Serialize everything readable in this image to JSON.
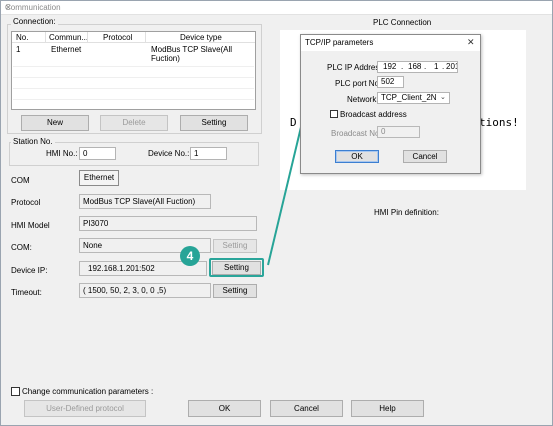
{
  "window": {
    "title": "Communication",
    "close_symbol": "✕"
  },
  "connection": {
    "group_label": "Connection:",
    "columns": [
      "No.",
      "Commun...",
      "Protocol",
      "Device type"
    ],
    "rows": [
      {
        "no": "1",
        "comm": "Ethernet",
        "protocol": "",
        "device_type": "ModBus TCP Slave(All Fuction)"
      }
    ],
    "buttons": {
      "new": "New",
      "delete": "Delete",
      "setting": "Setting"
    }
  },
  "station": {
    "group_label": "Station No.",
    "hmi_label": "HMI No.:",
    "hmi_value": "0",
    "device_label": "Device No.:",
    "device_value": "1"
  },
  "form": {
    "com_label": "COM",
    "com_value": "Ethernet",
    "protocol_label": "Protocol",
    "protocol_value": "ModBus TCP Slave(All Fuction)",
    "hmi_model_label": "HMI Model",
    "hmi_model_value": "PI3070",
    "com2_label": "COM:",
    "com2_value": "None",
    "com2_setting": "Setting",
    "device_ip_label": "Device IP:",
    "device_ip_value": "192.168.1.201:502",
    "device_ip_setting": "Setting",
    "timeout_label": "Timeout:",
    "timeout_value": "( 1500, 50, 2, 3, 0, 0 ,5)",
    "timeout_setting": "Setting"
  },
  "plc_connection": {
    "title": "PLC Connection",
    "preview_text_left": "D",
    "preview_text_right": "tions!"
  },
  "hmi_pin": {
    "label": "HMI Pin definition:"
  },
  "callout": {
    "step": "4",
    "accent_color": "#27a497"
  },
  "tcp_dialog": {
    "title": "TCP/IP parameters",
    "close_symbol": "✕",
    "ip_label": "PLC IP Address:",
    "ip_octets": [
      "192",
      "168",
      "1",
      "201"
    ],
    "port_label": "PLC port No.:",
    "port_value": "502",
    "network_label": "Network",
    "network_value": "TCP_Client_2N",
    "broadcast_check_label": "Broadcast address",
    "broadcast_no_label": "Broadcast No.:",
    "broadcast_no_value": "0",
    "ok": "OK",
    "cancel": "Cancel"
  },
  "footer": {
    "change_params_label": "Change communication parameters :",
    "user_defined": "User-Defined protocol",
    "ok": "OK",
    "cancel": "Cancel",
    "help": "Help"
  }
}
